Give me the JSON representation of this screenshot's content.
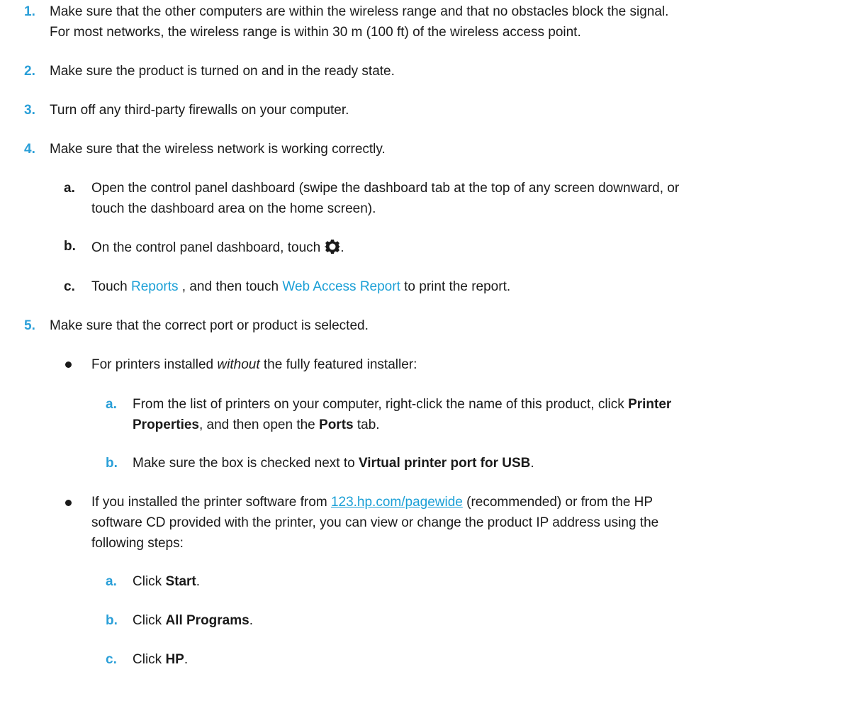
{
  "steps": [
    {
      "num": "1.",
      "line1": "Make sure that the other computers are within the wireless range and that no obstacles block the signal.",
      "line2": "For most networks, the wireless range is within 30 m (100 ft) of the wireless access point."
    },
    {
      "num": "2.",
      "text": "Make sure the product is turned on and in the ready state."
    },
    {
      "num": "3.",
      "text": "Turn off any third-party firewalls on your computer."
    },
    {
      "num": "4.",
      "text": "Make sure that the wireless network is working correctly.",
      "sub": [
        {
          "num": "a.",
          "line1": "Open the control panel dashboard (swipe the dashboard tab at the top of any screen downward, or",
          "line2": "touch the dashboard area on the home screen)."
        },
        {
          "num": "b.",
          "text": "On the control panel dashboard, touch",
          "tail": "."
        },
        {
          "num": "c.",
          "pre": "Touch ",
          "link1": "Reports",
          "mid": " , and then touch ",
          "link2": "Web Access Report",
          "post": " to print the report."
        }
      ]
    },
    {
      "num": "5.",
      "text": "Make sure that the correct port or product is selected.",
      "bullets": [
        {
          "pre": "For printers installed ",
          "em": "without",
          "post": " the fully featured installer:",
          "sub": [
            {
              "num": "a.",
              "l1_pre": "From the list of printers on your computer, right-click the name of this product, click ",
              "l1_bold": "Printer",
              "l2_bold": "Properties",
              "l2_mid": ", and then open the ",
              "l2_bold2": "Ports",
              "l2_post": " tab."
            },
            {
              "num": "b.",
              "pre": "Make sure the box is checked next to ",
              "bold": "Virtual printer port for USB",
              "post": "."
            }
          ]
        },
        {
          "l1_pre": "If you installed the printer software from ",
          "l1_link": "123.hp.com/pagewide",
          "l1_post": " (recommended) or from the HP",
          "line2": "software CD provided with the printer, you can view or change the product IP address using the",
          "line3": "following steps:",
          "sub": [
            {
              "num": "a.",
              "pre": "Click ",
              "bold": "Start",
              "post": "."
            },
            {
              "num": "b.",
              "pre": "Click ",
              "bold": "All Programs",
              "post": "."
            },
            {
              "num": "c.",
              "pre": "Click ",
              "bold": "HP",
              "post": "."
            }
          ]
        }
      ]
    }
  ],
  "icons": {
    "gear": "gear-icon"
  },
  "colors": {
    "accent": "#2a9fd8",
    "link": "#1a9fd6",
    "text": "#1a1a1a"
  }
}
